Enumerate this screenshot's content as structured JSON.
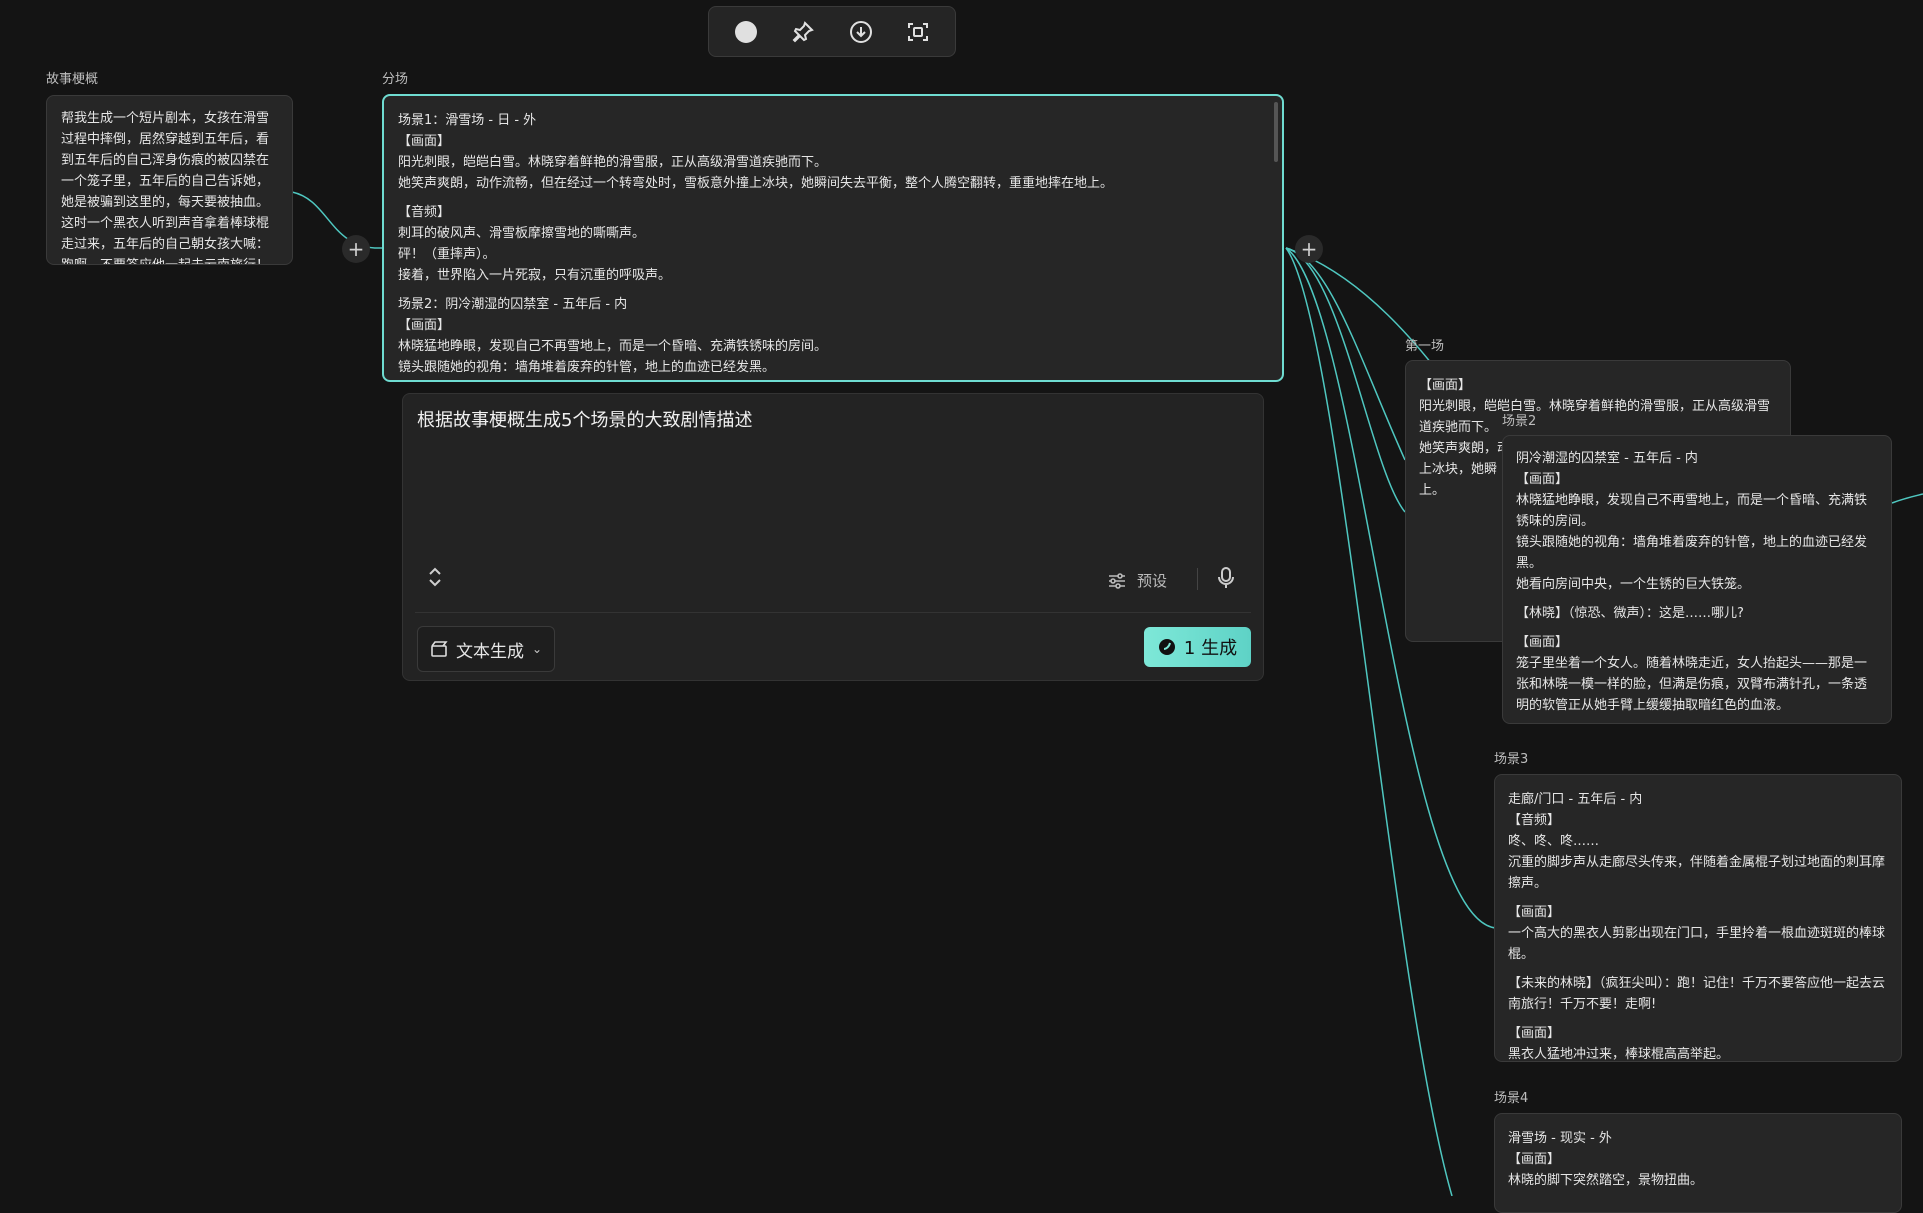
{
  "toolbar": {
    "icons": [
      "circle-icon",
      "pin-icon",
      "download-icon",
      "screenshot-icon"
    ]
  },
  "outline": {
    "label": "故事梗概",
    "text": "帮我生成一个短片剧本，女孩在滑雪过程中摔倒，居然穿越到五年后，看到五年后的自己浑身伤痕的被囚禁在一个笼子里，五年后的自己告诉她，她是被骗到这里的，每天要被抽血。这时一个黑衣人听到声音拿着棒球棍走过来，五年后的自己朝女孩大喊：跑啊，不要答应他一起去云南旅行！"
  },
  "scenes_node": {
    "label": "分场",
    "lines": [
      "场景1：滑雪场 - 日 - 外",
      "【画面】",
      "阳光刺眼，皑皑白雪。林晓穿着鲜艳的滑雪服，正从高级滑雪道疾驰而下。",
      "她笑声爽朗，动作流畅，但在经过一个转弯处时，雪板意外撞上冰块，她瞬间失去平衡，整个人腾空翻转，重重地摔在地上。",
      "",
      "【音频】",
      "刺耳的破风声、滑雪板摩擦雪地的嘶嘶声。",
      "砰！（重摔声）。",
      "接着，世界陷入一片死寂，只有沉重的呼吸声。",
      "",
      "场景2：阴冷潮湿的囚禁室 - 五年后 - 内",
      "【画面】",
      "林晓猛地睁眼，发现自己不再雪地上，而是一个昏暗、充满铁锈味的房间。",
      "镜头跟随她的视角：墙角堆着废弃的针管，地上的血迹已经发黑。"
    ]
  },
  "prompt": {
    "text": "根据故事梗概生成5个场景的大致剧情描述",
    "preset_label": "预设",
    "mode_label": "文本生成",
    "generate_label": "1 生成"
  },
  "scene1": {
    "label": "第一场",
    "lines": [
      "【画面】",
      "阳光刺眼，皑皑白雪。林晓穿着鲜艳的滑雪服，正从高级滑雪道疾驰而下。",
      "她笑声爽朗，动",
      "上冰块，她瞬",
      "上。"
    ]
  },
  "scene2": {
    "label": "场景2",
    "lines": [
      "阴冷潮湿的囚禁室 - 五年后 - 内",
      "【画面】",
      "林晓猛地睁眼，发现自己不再雪地上，而是一个昏暗、充满铁锈味的房间。",
      "镜头跟随她的视角：墙角堆着废弃的针管，地上的血迹已经发黑。",
      "她看向房间中央，一个生锈的巨大铁笼。",
      "",
      "【林晓】（惊恐、微声）：这是……哪儿?",
      "",
      "【画面】",
      "笼子里坐着一个女人。随着林晓走近，女人抬起头——那是一张和林晓一模一样的脸，但满是伤痕，双臂布满针孔，一条透明的软管正从她手臂上缓缓抽取暗红色的血液。"
    ]
  },
  "scene3": {
    "label": "场景3",
    "lines": [
      "走廊/门口 - 五年后 - 内",
      "【音频】",
      "咚、咚、咚……",
      "沉重的脚步声从走廊尽头传来，伴随着金属棍子划过地面的刺耳摩擦声。",
      "",
      "【画面】",
      "一个高大的黑衣人剪影出现在门口，手里拎着一根血迹斑斑的棒球棍。",
      "",
      "【未来的林晓】（疯狂尖叫）：跑！记住！千万不要答应他一起去云南旅行！千万不要！走啊!",
      "",
      "【画面】",
      "黑衣人猛地冲过来，棒球棍高高举起。"
    ]
  },
  "scene4": {
    "label": "场景4",
    "lines": [
      "滑雪场 - 现实 - 外",
      "【画面】",
      "林晓的脚下突然踏空，景物扭曲。"
    ]
  },
  "colors": {
    "accent": "#5ed2c6",
    "edge": "#4fc7c0"
  }
}
